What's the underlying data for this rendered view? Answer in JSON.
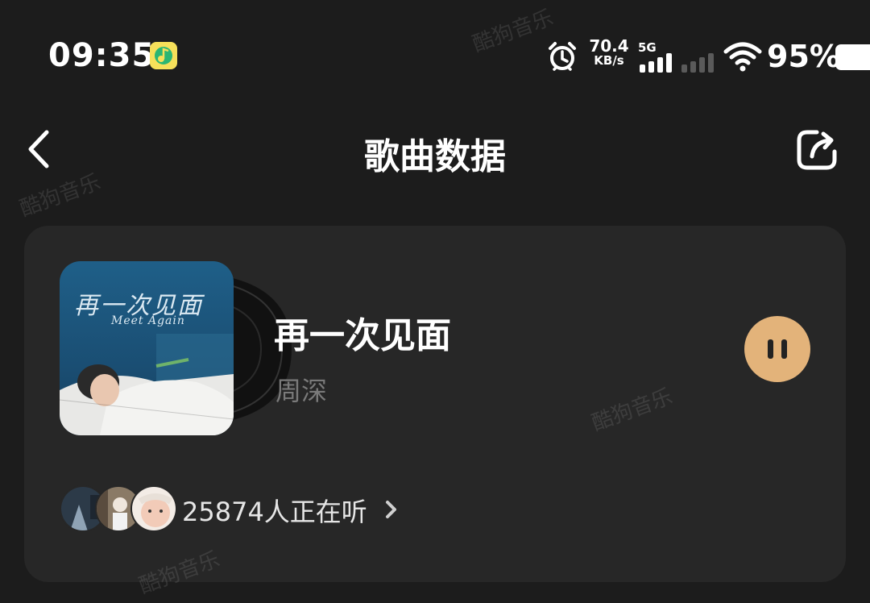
{
  "status_bar": {
    "time": "09:35",
    "net_speed_value": "70.4",
    "net_speed_unit": "KB/s",
    "network_type": "5G",
    "battery_percent": "95%",
    "icons": [
      "qq-music-app-icon",
      "alarm-icon",
      "signal-icon",
      "signal-icon-secondary",
      "wifi-icon",
      "battery-icon"
    ]
  },
  "header": {
    "title": "歌曲数据",
    "back_icon": "chevron-left-icon",
    "share_icon": "share-icon"
  },
  "song_card": {
    "cover_title": "再一次见面",
    "cover_subtitle": "Meet Again",
    "title": "再一次见面",
    "artist": "周深",
    "playback_state_icon": "pause-icon",
    "accent_color": "#e3b37a",
    "listeners": {
      "text": "25874人正在听",
      "chevron_icon": "chevron-right-icon",
      "avatars": [
        "avatar-1",
        "avatar-2",
        "avatar-3"
      ]
    }
  },
  "watermark": "酷狗音乐",
  "colors": {
    "background": "#1c1c1c",
    "card": "#272727",
    "secondary_text": "#7a7a7a"
  }
}
